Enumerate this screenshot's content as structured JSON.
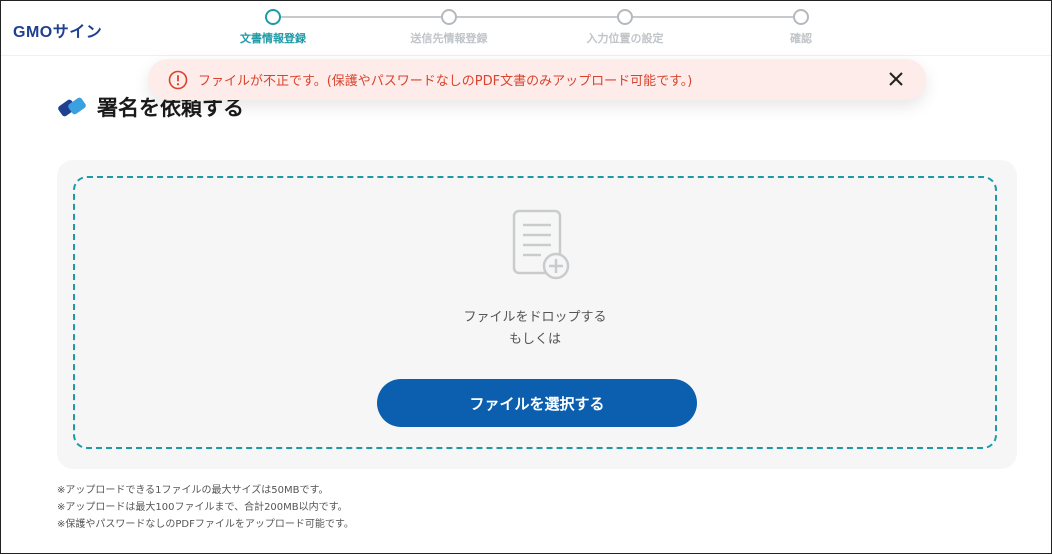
{
  "header": {
    "logo": "GMOサイン",
    "steps": [
      {
        "label": "文書情報登録",
        "active": true
      },
      {
        "label": "送信先情報登録",
        "active": false
      },
      {
        "label": "入力位置の設定",
        "active": false
      },
      {
        "label": "確認",
        "active": false
      }
    ]
  },
  "page": {
    "title": "署名を依頼する"
  },
  "alert": {
    "message": "ファイルが不正です。(保護やパスワードなしのPDF文書のみアップロード可能です。)",
    "icon": "exclamation-circle-icon",
    "close_icon": "close-icon"
  },
  "dropzone": {
    "line1": "ファイルをドロップする",
    "line2": "もしくは",
    "button_label": "ファイルを選択する",
    "icon": "document-add-icon"
  },
  "notes": [
    "※アップロードできる1ファイルの最大サイズは50MBです。",
    "※アップロードは最大100ファイルまで、合計200MB以内です。",
    "※保護やパスワードなしのPDFファイルをアップロード可能です。"
  ],
  "colors": {
    "accent": "#1f9aa6",
    "primary_button": "#0c5fae",
    "error_text": "#d9442f",
    "error_bg": "#fdece9"
  }
}
